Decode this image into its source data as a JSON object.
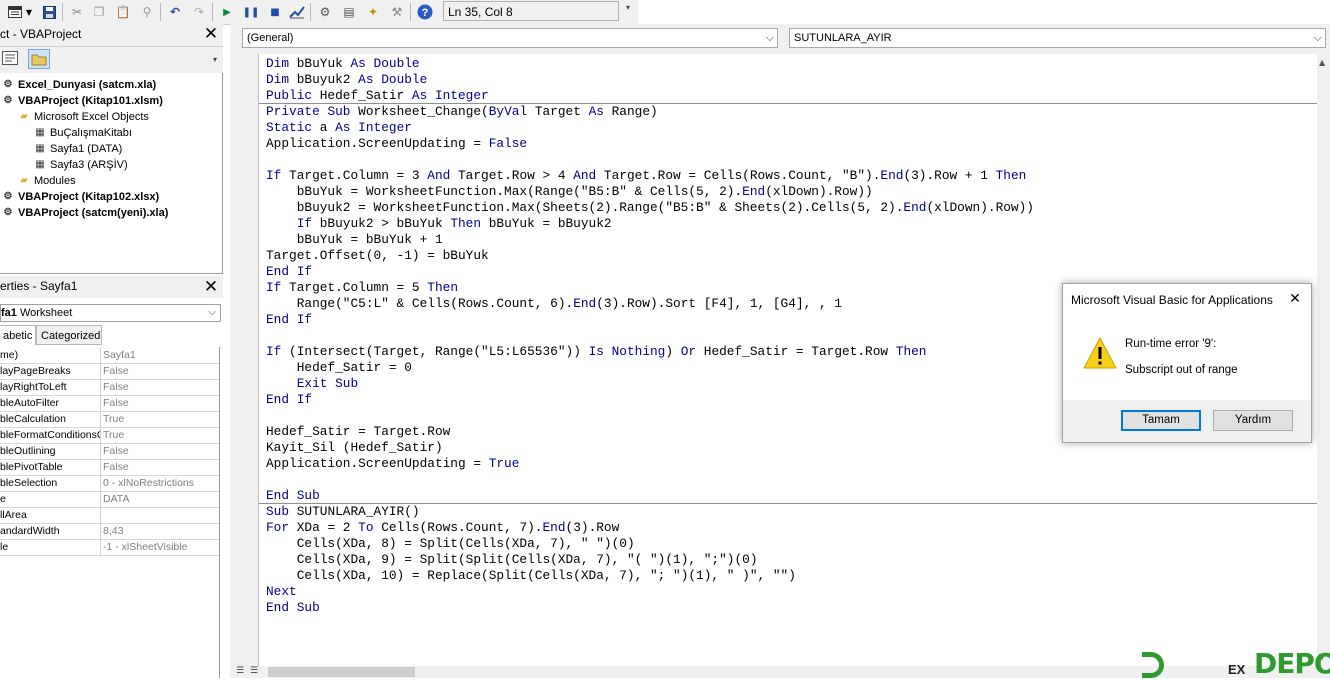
{
  "toolbar": {
    "status": "Ln 35, Col 8",
    "icons": [
      "view-icon",
      "dropdown-icon",
      "save-icon",
      "cut-icon",
      "copy-icon",
      "paste-icon",
      "find-icon",
      "undo-icon",
      "redo-icon",
      "run-icon",
      "pause-icon",
      "reset-icon",
      "design-mode-icon",
      "project-explorer-icon",
      "properties-icon",
      "object-browser-icon",
      "toolbox-icon",
      "help-icon"
    ]
  },
  "project": {
    "title": "ct - VBAProject",
    "tree": [
      {
        "label": "Excel_Dunyasi (satcm.xla)",
        "bold": true,
        "indent": 0
      },
      {
        "label": "VBAProject (Kitap101.xlsm)",
        "bold": true,
        "indent": 0
      },
      {
        "label": "Microsoft Excel Objects",
        "bold": false,
        "indent": 1
      },
      {
        "label": "BuÇalışmaKitabı",
        "bold": false,
        "indent": 2
      },
      {
        "label": "Sayfa1 (DATA)",
        "bold": false,
        "indent": 2
      },
      {
        "label": "Sayfa3 (ARŞİV)",
        "bold": false,
        "indent": 2
      },
      {
        "label": "Modules",
        "bold": false,
        "indent": 1
      },
      {
        "label": "VBAProject (Kitap102.xlsx)",
        "bold": true,
        "indent": 0
      },
      {
        "label": "VBAProject (satcm(yeni).xla)",
        "bold": true,
        "indent": 0
      }
    ]
  },
  "properties": {
    "title": "erties - Sayfa1",
    "object_bold": "fa1",
    "object_type": " Worksheet",
    "tabs": [
      "abetic",
      "Categorized"
    ],
    "rows": [
      {
        "name": "me)",
        "value": "Sayfa1"
      },
      {
        "name": "layPageBreaks",
        "value": "False"
      },
      {
        "name": "layRightToLeft",
        "value": "False"
      },
      {
        "name": "bleAutoFilter",
        "value": "False"
      },
      {
        "name": "bleCalculation",
        "value": "True"
      },
      {
        "name": "bleFormatConditionsC",
        "value": "True"
      },
      {
        "name": "bleOutlining",
        "value": "False"
      },
      {
        "name": "blePivotTable",
        "value": "False"
      },
      {
        "name": "bleSelection",
        "value": "0 - xlNoRestrictions"
      },
      {
        "name": "e",
        "value": "DATA"
      },
      {
        "name": "llArea",
        "value": ""
      },
      {
        "name": "andardWidth",
        "value": "8,43"
      },
      {
        "name": "le",
        "value": "-1 - xlSheetVisible"
      }
    ]
  },
  "code": {
    "object_combo": "(General)",
    "proc_combo": "SUTUNLARA_AYIR",
    "lines": [
      "Dim bBuYuk As Double",
      "Dim bBuyuk2 As Double",
      "Public Hedef_Satir As Integer",
      "Private Sub Worksheet_Change(ByVal Target As Range)",
      "Static a As Integer",
      "Application.ScreenUpdating = False",
      "",
      "If Target.Column = 3 And Target.Row > 4 And Target.Row = Cells(Rows.Count, \"B\").End(3).Row + 1 Then",
      "    bBuYuk = WorksheetFunction.Max(Range(\"B5:B\" & Cells(5, 2).End(xlDown).Row))",
      "    bBuyuk2 = WorksheetFunction.Max(Sheets(2).Range(\"B5:B\" & Sheets(2).Cells(5, 2).End(xlDown).Row))",
      "    If bBuyuk2 > bBuYuk Then bBuYuk = bBuyuk2",
      "    bBuYuk = bBuYuk + 1",
      "Target.Offset(0, -1) = bBuYuk",
      "End If",
      "If Target.Column = 5 Then",
      "    Range(\"C5:L\" & Cells(Rows.Count, 6).End(3).Row).Sort [F4], 1, [G4], , 1",
      "End If",
      "",
      "If (Intersect(Target, Range(\"L5:L65536\")) Is Nothing) Or Hedef_Satir = Target.Row Then",
      "    Hedef_Satir = 0",
      "    Exit Sub",
      "End If",
      "",
      "Hedef_Satir = Target.Row",
      "Kayit_Sil (Hedef_Satir)",
      "Application.ScreenUpdating = True",
      "",
      "End Sub",
      "Sub SUTUNLARA_AYIR()",
      "For XDa = 2 To Cells(Rows.Count, 7).End(3).Row",
      "    Cells(XDa, 8) = Split(Cells(XDa, 7), \" \")(0)",
      "    Cells(XDa, 9) = Split(Split(Cells(XDa, 7), \"( \")(1), \";\")(0)",
      "    Cells(XDa, 10) = Replace(Split(Cells(XDa, 7), \"; \")(1), \" )\", \"\")",
      "Next",
      "End Sub"
    ]
  },
  "dialog": {
    "title": "Microsoft Visual Basic for Applications",
    "message1": "Run-time error '9':",
    "message2": "Subscript out of range",
    "ok_label": "Tamam",
    "help_label": "Yardım"
  },
  "watermark": {
    "logo": "DEPO",
    "behind": "EX"
  },
  "colors": {
    "keyword": "#00008b",
    "dialog_ok_border": "#0078d7",
    "watermark_green": "#2e9b2e"
  }
}
